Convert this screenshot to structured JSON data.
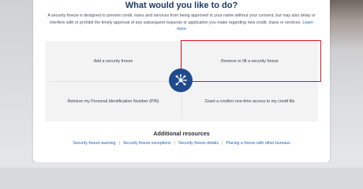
{
  "heading": "What would you like to do?",
  "description": "A security freeze is designed to prevent credit, loans and services from being approved in your name without your consent, but may also delay or interfere with or prohibit the timely approval of any subsequent requests or application you make regarding new credit, loans or services.",
  "learn_more": "Learn more",
  "options": [
    {
      "label": "Add a security freeze"
    },
    {
      "label": "Remove or lift a security freeze"
    },
    {
      "label": "Retrieve my Personal Identification Number (PIN)"
    },
    {
      "label": "Grant a creditor one-time access to my credit file"
    }
  ],
  "resources": {
    "title": "Additional resources",
    "links": [
      "Security freeze warning",
      "Security freeze exceptions",
      "Security freeze details",
      "Placing a freeze with other bureaus"
    ]
  },
  "colors": {
    "heading": "#1b3b66",
    "link": "#1a63b8",
    "hub": "#1f4b8e",
    "highlight": "#e0141e"
  },
  "icons": {
    "hub": "network-hub-icon"
  }
}
